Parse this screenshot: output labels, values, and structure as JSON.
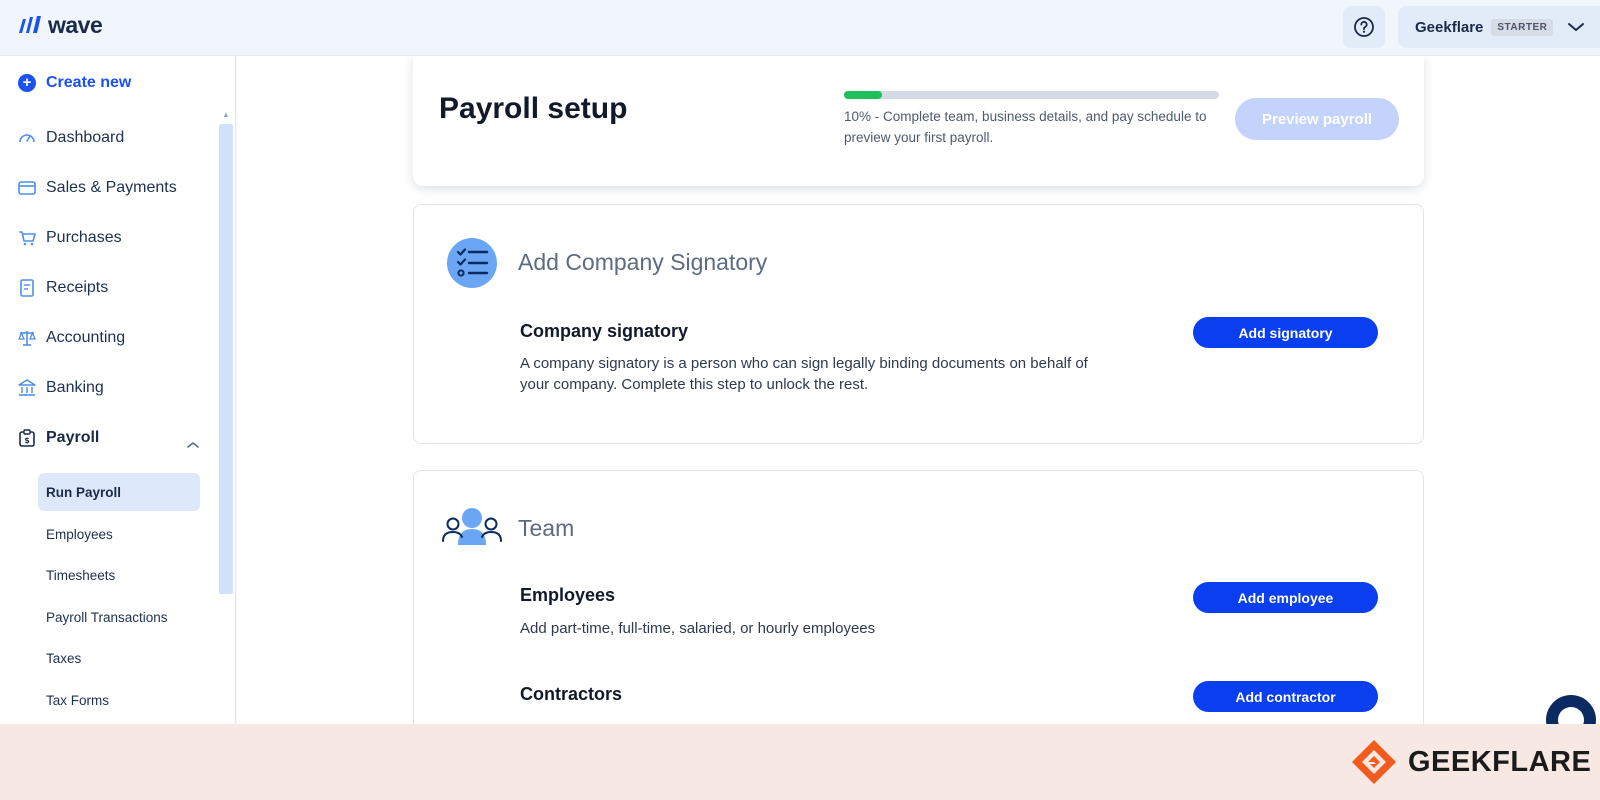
{
  "brand": {
    "name": "wave",
    "accent": "#1c52f0"
  },
  "header": {
    "help_icon": "question-circle-icon",
    "account_name": "Geekflare",
    "plan": "STARTER"
  },
  "sidebar": {
    "create_new": "Create new",
    "items": [
      {
        "label": "Dashboard",
        "icon": "gauge-icon"
      },
      {
        "label": "Sales & Payments",
        "icon": "credit-card-icon"
      },
      {
        "label": "Purchases",
        "icon": "cart-icon"
      },
      {
        "label": "Receipts",
        "icon": "receipt-icon"
      },
      {
        "label": "Accounting",
        "icon": "scales-icon"
      },
      {
        "label": "Banking",
        "icon": "bank-icon"
      },
      {
        "label": "Payroll",
        "icon": "payroll-icon"
      }
    ],
    "payroll_sub": [
      {
        "label": "Run Payroll",
        "active": true
      },
      {
        "label": "Employees"
      },
      {
        "label": "Timesheets"
      },
      {
        "label": "Payroll Transactions"
      },
      {
        "label": "Taxes"
      },
      {
        "label": "Tax Forms"
      }
    ]
  },
  "setup": {
    "title": "Payroll setup",
    "progress": 0.1,
    "progress_text": "10% - Complete team, business details, and pay schedule to preview your first payroll.",
    "preview_button": "Preview payroll"
  },
  "signatory_section": {
    "title": "Add Company Signatory",
    "icon": "checklist-icon",
    "row_title": "Company signatory",
    "row_desc": "A company signatory is a person who can sign legally binding documents on behalf of your company. Complete this step to unlock the rest.",
    "button": "Add signatory"
  },
  "team_section": {
    "title": "Team",
    "icon": "team-icon",
    "employees_title": "Employees",
    "employees_desc": "Add part-time, full-time, salaried, or hourly employees",
    "employees_button": "Add employee",
    "contractors_title": "Contractors",
    "contractors_button": "Add contractor"
  },
  "watermark": {
    "text": "GEEKFLARE",
    "color": "#f25a1e"
  }
}
